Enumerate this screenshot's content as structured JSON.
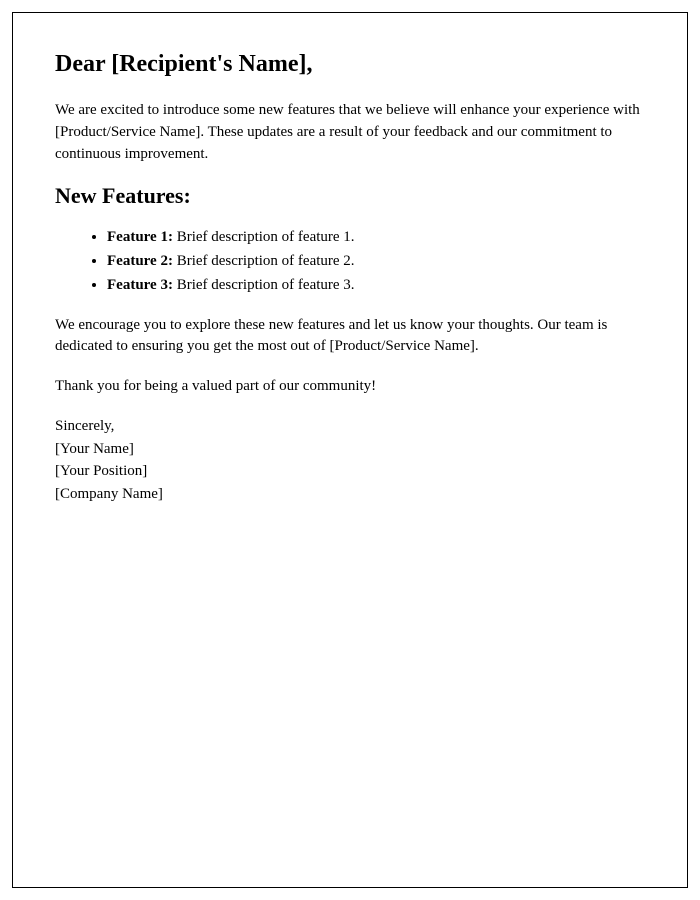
{
  "greeting": "Dear [Recipient's Name],",
  "intro": "We are excited to introduce some new features that we believe will enhance your experience with [Product/Service Name]. These updates are a result of your feedback and our commitment to continuous improvement.",
  "section_heading": "New Features:",
  "features": [
    {
      "label": "Feature 1:",
      "desc": " Brief description of feature 1."
    },
    {
      "label": "Feature 2:",
      "desc": " Brief description of feature 2."
    },
    {
      "label": "Feature 3:",
      "desc": " Brief description of feature 3."
    }
  ],
  "explore": "We encourage you to explore these new features and let us know your thoughts. Our team is dedicated to ensuring you get the most out of [Product/Service Name].",
  "thanks": "Thank you for being a valued part of our community!",
  "signature": {
    "closing": "Sincerely,",
    "name": "[Your Name]",
    "position": "[Your Position]",
    "company": "[Company Name]"
  }
}
